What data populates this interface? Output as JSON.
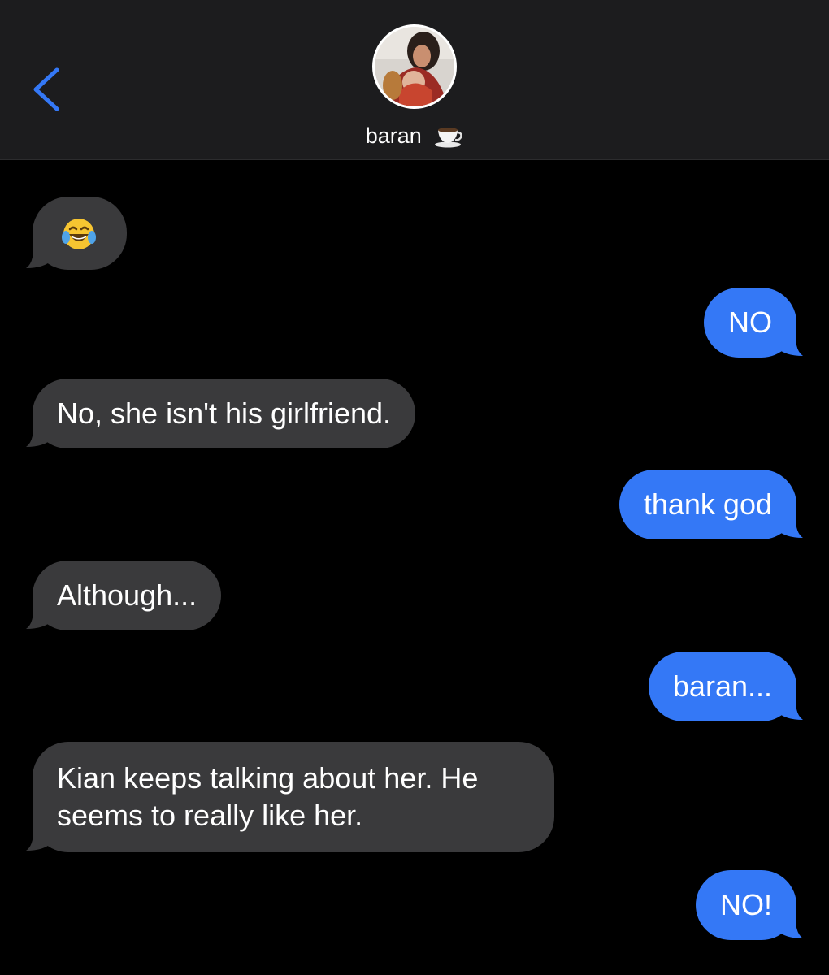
{
  "header": {
    "contact_name": "baran",
    "name_emoji_icon": "coffee-cup-icon",
    "back_icon": "chevron-left-icon",
    "accent_color": "#3478f6"
  },
  "messages": [
    {
      "direction": "incoming",
      "kind": "emoji",
      "icon": "face-with-tears-of-joy-icon",
      "text": "😂"
    },
    {
      "direction": "outgoing",
      "text": "NO"
    },
    {
      "direction": "incoming",
      "text": "No, she isn't his girlfriend."
    },
    {
      "direction": "outgoing",
      "text": "thank god"
    },
    {
      "direction": "incoming",
      "text": "Although..."
    },
    {
      "direction": "outgoing",
      "text": "baran..."
    },
    {
      "direction": "incoming",
      "text_line1": "Kian keeps talking about her. He",
      "text_line2": "seems to really like her."
    },
    {
      "direction": "outgoing",
      "text": "NO!"
    }
  ],
  "colors": {
    "incoming_bubble": "#3a3a3c",
    "outgoing_bubble": "#3478f6",
    "header_bg": "#1c1c1e"
  }
}
